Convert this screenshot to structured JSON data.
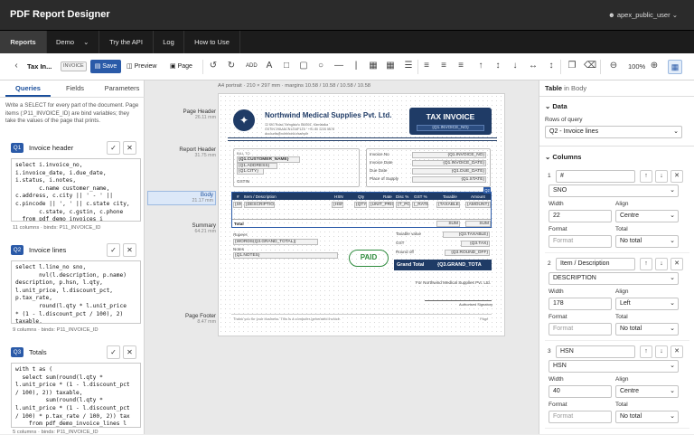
{
  "app": {
    "title": "PDF Report Designer",
    "user": "apex_public_user"
  },
  "nav": [
    "Reports",
    "Demo",
    "Try the API",
    "Log",
    "How to Use"
  ],
  "toolbar": {
    "report_name": "Tax In...",
    "report_tag": "INVOICE",
    "save": "Save",
    "preview": "Preview",
    "page": "Page",
    "add": "ADD",
    "zoom": "100%"
  },
  "left": {
    "tabs": [
      "Queries",
      "Fields",
      "Parameters"
    ],
    "description": "Write a SELECT for every part of the document. Page items (:P11_INVOICE_ID) are bind variables; they take the values of the page that prints.",
    "queries": [
      {
        "badge": "Q1",
        "name": "Invoice header",
        "code": "select i.invoice_no,\ni.invoice_date, i.due_date,\ni.status, i.notes,\n       c.name customer_name,\nc.address, c.city || ' - ' ||\nc.pincode || ', ' || c.state city,\n       c.state, c.gstin, c.phone\n  from pdf_demo_invoices i",
        "meta": "11 columns · binds: P11_INVOICE_ID"
      },
      {
        "badge": "Q2",
        "name": "Invoice lines",
        "code": "select l.line_no sno,\n       nvl(l.description, p.name)\ndescription, p.hsn, l.qty,\nl.unit_price, l.discount_pct,\np.tax_rate,\n       round(l.qty * l.unit_price\n* (1 - l.discount_pct / 100), 2)\ntaxable,",
        "meta": "9 columns · binds: P11_INVOICE_ID"
      },
      {
        "badge": "Q3",
        "name": "Totals",
        "code": "with t as (\n  select sum(round(l.qty *\nl.unit_price * (1 - l.discount_pct\n/ 100), 2)) taxable,\n         sum(round(l.qty *\nl.unit_price * (1 - l.discount_pct\n/ 100) * p.tax_rate / 100, 2)) tax\n    from pdf_demo_invoice_lines l",
        "meta": "5 columns · binds: P11_INVOICE_ID"
      }
    ]
  },
  "canvas": {
    "caption": "A4 portrait · 210 × 297 mm · margins 10.58 / 10.58 / 10.58 / 10.58",
    "bands": [
      {
        "name": "Page Header",
        "size": "26.11 mm"
      },
      {
        "name": "Report Header",
        "size": "31.75 mm"
      },
      {
        "name": "Body",
        "size": "21.17 mm"
      },
      {
        "name": "Summary",
        "size": "64.21 mm"
      },
      {
        "name": "Page Footer",
        "size": "8.47 mm"
      }
    ],
    "doc": {
      "company": "Northwind Medical Supplies Pvt. Ltd.",
      "addr1": "12 MG Road, Bengaluru 560001, Karnataka",
      "addr2": "GSTIN 29AAACN1234F1Z5 · +91 80 1234 5678",
      "addr3": "accounts@northwind.example",
      "doctitle": "TAX INVOICE",
      "invno_field": "{Q1.INVOICE_NO}",
      "bill_to": "BILL TO",
      "cust_field": "{Q1.CUSTOMER_NAME}",
      "addr_field": "{Q1.ADDRESS}",
      "city_field": "{Q1.CITY}",
      "gstin_label": "GSTIN",
      "meta_labels": [
        "Invoice No",
        "Invoice Date",
        "Due Date",
        "Place of Supply"
      ],
      "meta_fields": [
        "{Q1.INVOICE_NO}",
        "{Q1.INVOICE_DATE}",
        "{Q1.DUE_DATE}",
        "{Q1.STATE}"
      ],
      "table_headers": [
        "#",
        "Item / Description",
        "HSN",
        "Qty",
        "Rate",
        "Disc %",
        "GST %",
        "Taxable",
        "Amount"
      ],
      "table_fields": [
        "{SNO}",
        "{DESCRIPTION}",
        "{HSN}",
        "{QTY}",
        "{UNIT_PRICE}",
        "{T_PCT}",
        "{_RATE}",
        "{TAXABLE}",
        "{AMOUNT}"
      ],
      "band_tag": "Q2",
      "total_label": "Total",
      "total_fields": [
        "SUM",
        "SUM"
      ],
      "rupees_label": "Rupees",
      "words_field": "{WORDS(Q3.GRAND_TOTAL)}",
      "notes_label": "Notes",
      "notes_field": "{Q1.NOTES}",
      "paid": "PAID",
      "sum_labels": [
        "Taxable value",
        "GST",
        "Round off"
      ],
      "sum_fields": [
        "{Q3.TAXABLE}",
        "{Q3.TAX}",
        "{Q3.ROUND_OFF}"
      ],
      "grand_label": "Grand Total",
      "grand_field": "{Q3.GRAND_TOTA",
      "for_company": "For Northwind Medical Supplies Pvt. Ltd.",
      "auth_sig": "Authorised Signatory",
      "footer_text": "Thank you for your business. This is a computer-generated invoice.",
      "page_field": "Page"
    }
  },
  "right": {
    "header_main": "Table",
    "header_sub": "in Body",
    "data_section": "Data",
    "rows_label": "Rows of query",
    "rows_value": "Q2 - Invoice lines",
    "columns_section": "Columns",
    "columns": [
      {
        "num": "1",
        "label": "#",
        "field": "SNO",
        "width": "22",
        "align": "Centre",
        "format": "Format",
        "total": "No total"
      },
      {
        "num": "2",
        "label": "Item / Description",
        "field": "DESCRIPTION",
        "width": "178",
        "align": "Left",
        "format": "Format",
        "total": "No total"
      },
      {
        "num": "3",
        "label": "HSN",
        "field": "HSN",
        "width": "40",
        "align": "Centre",
        "format": "Format",
        "total": "No total"
      }
    ],
    "labels": {
      "width": "Width",
      "align": "Align",
      "format": "Format",
      "total": "Total"
    }
  },
  "colors": {
    "accent": "#2a5aa8",
    "dark_header": "#1f3b66",
    "paid": "#2e8b3d"
  }
}
